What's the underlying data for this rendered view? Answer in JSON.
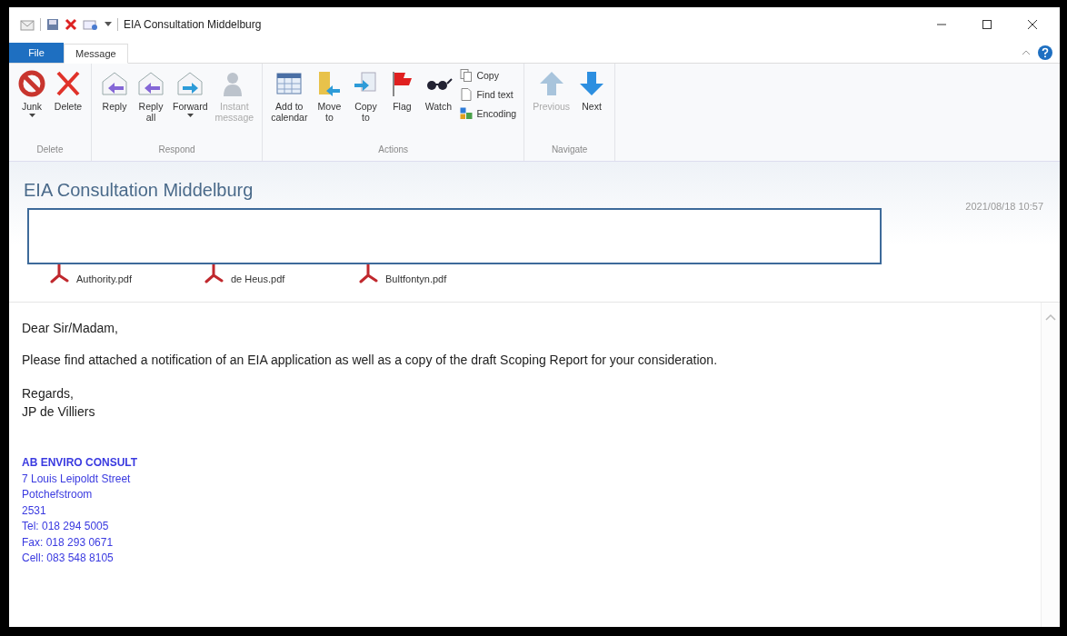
{
  "window": {
    "title": "EIA Consultation Middelburg"
  },
  "tabs": [
    {
      "label": "File",
      "kind": "file",
      "selected": false
    },
    {
      "label": "Message",
      "kind": "tab",
      "selected": true
    }
  ],
  "ribbon": {
    "groups": [
      {
        "label": "Delete",
        "items": [
          {
            "label": "Junk",
            "kind": "large",
            "dropdown": true,
            "disabled": false
          },
          {
            "label": "Delete",
            "kind": "large",
            "dropdown": false,
            "disabled": false
          }
        ]
      },
      {
        "label": "Respond",
        "items": [
          {
            "label": "Reply",
            "kind": "large",
            "dropdown": false,
            "disabled": false
          },
          {
            "label": "Reply\nall",
            "kind": "large",
            "dropdown": false,
            "disabled": false
          },
          {
            "label": "Forward",
            "kind": "large",
            "dropdown": true,
            "disabled": false
          },
          {
            "label": "Instant\nmessage",
            "kind": "large",
            "dropdown": false,
            "disabled": true
          }
        ]
      },
      {
        "label": "Actions",
        "items": [
          {
            "label": "Add to\ncalendar",
            "kind": "large",
            "dropdown": false,
            "disabled": false
          },
          {
            "label": "Move\nto",
            "kind": "large",
            "dropdown": false,
            "disabled": false
          },
          {
            "label": "Copy\nto",
            "kind": "large",
            "dropdown": false,
            "disabled": false
          },
          {
            "label": "Flag",
            "kind": "large",
            "dropdown": false,
            "disabled": false
          },
          {
            "label": "Watch",
            "kind": "large",
            "dropdown": false,
            "disabled": false
          },
          {
            "label": "Copy",
            "kind": "small",
            "dropdown": false,
            "disabled": false
          },
          {
            "label": "Find text",
            "kind": "small",
            "dropdown": false,
            "disabled": false
          },
          {
            "label": "Encoding",
            "kind": "small",
            "dropdown": false,
            "disabled": false
          }
        ]
      },
      {
        "label": "Navigate",
        "items": [
          {
            "label": "Previous",
            "kind": "large",
            "dropdown": false,
            "disabled": true
          },
          {
            "label": "Next",
            "kind": "large",
            "dropdown": false,
            "disabled": false
          }
        ]
      }
    ]
  },
  "message": {
    "subject": "EIA Consultation Middelburg",
    "date": "2021/08/18 10:57",
    "attachments": [
      {
        "name": "Authority.pdf"
      },
      {
        "name": "de Heus.pdf"
      },
      {
        "name": "Bultfontyn.pdf"
      }
    ],
    "body": [
      {
        "kind": "text",
        "text": "Dear Sir/Madam,"
      },
      {
        "kind": "text",
        "text": "Please find attached a notification of an EIA application as well as a copy of the draft Scoping Report for your consideration."
      },
      {
        "kind": "lines",
        "lines": [
          "Regards,",
          "JP de Villiers"
        ]
      }
    ],
    "signature": [
      "AB ENVIRO CONSULT",
      "7 Louis Leipoldt Street",
      "Potchefstroom",
      "2531",
      "Tel:  018 294 5005",
      "Fax: 018 293 0671",
      "Cell: 083 548 8105"
    ]
  }
}
